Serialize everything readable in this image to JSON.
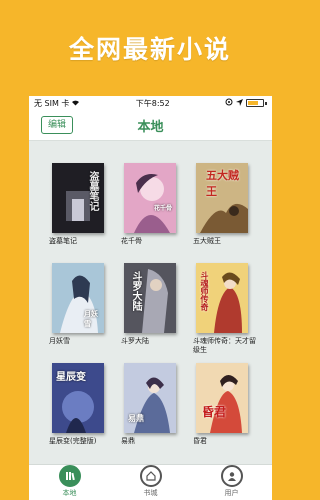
{
  "promo": {
    "headline": "全网最新小说"
  },
  "status_bar": {
    "carrier": "无 SIM 卡",
    "time": "下午8:52"
  },
  "nav": {
    "edit_label": "编辑",
    "title": "本地"
  },
  "books": [
    {
      "title": "盗墓笔记",
      "cover_text": "盗墓笔记",
      "cover_color": "#26252b"
    },
    {
      "title": "花千骨",
      "cover_text": "花千骨",
      "cover_color": "#d995b9"
    },
    {
      "title": "五大贼王",
      "cover_text": "五大贼王",
      "cover_color": "#b9a06e"
    },
    {
      "title": "月妖雪",
      "cover_text": "月妖雪",
      "cover_color": "#8fb1c6"
    },
    {
      "title": "斗罗大陆",
      "cover_text": "斗罗大陆",
      "cover_color": "#6b6b73"
    },
    {
      "title": "斗魂师传奇：天才留级生",
      "cover_text": "斗魂师传奇",
      "cover_color": "#e1b64e"
    },
    {
      "title": "星辰变(完整版)",
      "cover_text": "星辰变",
      "cover_color": "#4c5a9e"
    },
    {
      "title": "易鼎",
      "cover_text": "易鼎",
      "cover_color": "#aab4cf"
    },
    {
      "title": "昏君",
      "cover_text": "昏君",
      "cover_color": "#d8705d"
    }
  ],
  "tabs": [
    {
      "label": "本地",
      "icon": "bookshelf-icon",
      "active": true
    },
    {
      "label": "书城",
      "icon": "store-icon",
      "active": false
    },
    {
      "label": "用户",
      "icon": "user-icon",
      "active": false
    }
  ],
  "colors": {
    "accent": "#3a8f5a",
    "background": "#f6b62a"
  }
}
